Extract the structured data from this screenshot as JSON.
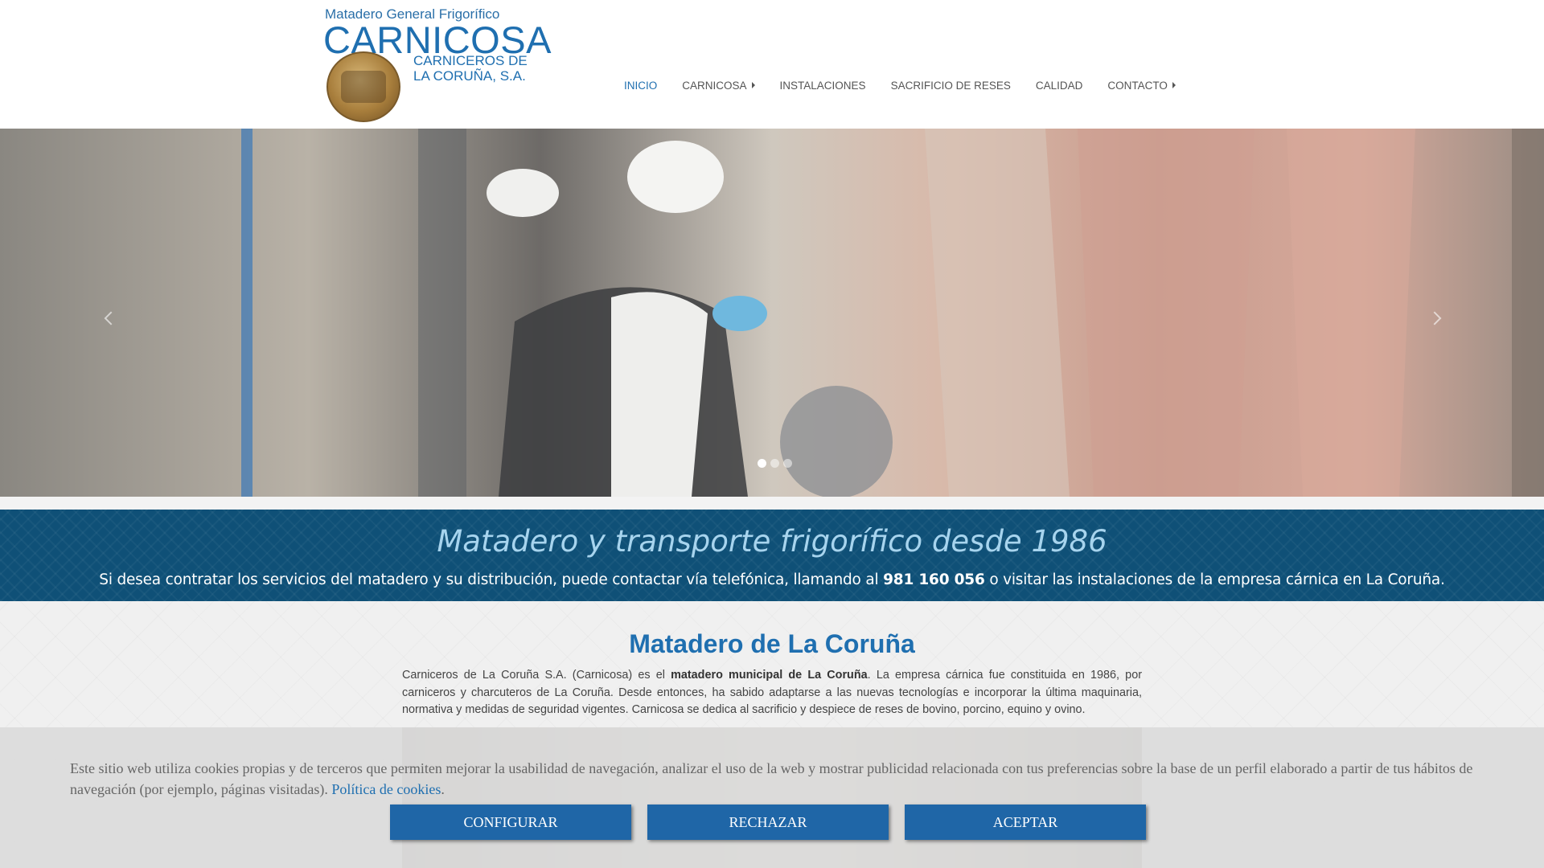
{
  "logo": {
    "top": "Matadero General Frigorífico",
    "main": "CARNICOSA",
    "sub1": "CARNICEROS DE",
    "sub2": "LA CORUÑA, S.A."
  },
  "nav": {
    "items": [
      {
        "label": "INICIO",
        "active": true,
        "dropdown": false
      },
      {
        "label": "CARNICOSA",
        "active": false,
        "dropdown": true
      },
      {
        "label": "INSTALACIONES",
        "active": false,
        "dropdown": false
      },
      {
        "label": "SACRIFICIO DE RESES",
        "active": false,
        "dropdown": false
      },
      {
        "label": "CALIDAD",
        "active": false,
        "dropdown": false
      },
      {
        "label": "CONTACTO",
        "active": false,
        "dropdown": true
      }
    ]
  },
  "slider": {
    "slide_count": 3,
    "active_slide": 1,
    "prev_icon": "chevron-left-icon",
    "next_icon": "chevron-right-icon"
  },
  "band": {
    "title": "Matadero y transporte frigorífico desde 1986",
    "text_before": "Si desea contratar los servicios del matadero y su distribución, puede contactar vía telefónica, llamando al ",
    "phone": "981 160 056",
    "text_after": " o visitar las instalaciones de la empresa cárnica en La Coruña."
  },
  "section": {
    "title": "Matadero de La Coruña",
    "text_before": "Carniceros de La Coruña S.A. (Carnicosa) es el ",
    "text_bold": "matadero municipal de La Coruña",
    "text_after": ". La empresa cárnica fue constituida en 1986, por carniceros y charcuteros de La Coruña. Desde entonces, ha sabido adaptarse a las nuevas tecnologías e incorporar la última maquinaria, normativa y medidas de seguridad vigentes. Carnicosa se dedica al sacrificio y despiece de reses de bovino, porcino, equino y ovino."
  },
  "cookie": {
    "text": "Este sitio web utiliza cookies propias y de terceros que permiten mejorar la usabilidad de navegación, analizar el uso de la web y mostrar publicidad relacionada con tus preferencias sobre la base de un perfil elaborado a partir de tus hábitos de navegación (por ejemplo, páginas visitadas). ",
    "link": "Política de cookies",
    "link_suffix": ".",
    "configure": "Configurar",
    "reject": "Rechazar",
    "accept": "Aceptar"
  },
  "colors": {
    "accent": "#1f6fb0",
    "band_bg": "#0f5077",
    "band_title": "#a7d4ee",
    "button_bg": "#1f66a7"
  }
}
